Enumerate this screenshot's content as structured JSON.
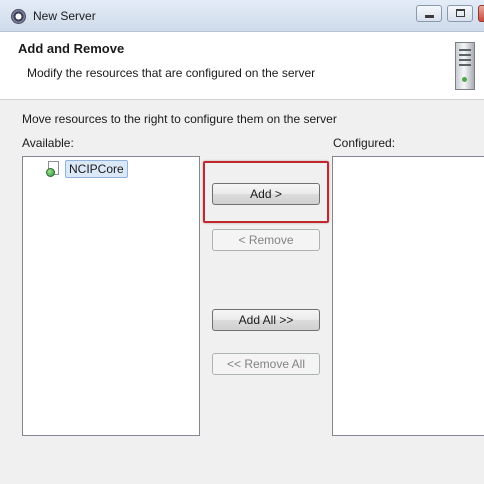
{
  "window": {
    "title": "New Server"
  },
  "header": {
    "title": "Add and Remove",
    "description": "Modify the resources that are configured on the server"
  },
  "main": {
    "instruction": "Move resources to the right to configure them on the server",
    "available_label": "Available:",
    "configured_label": "Configured:",
    "available_items": [
      {
        "label": "NCIPCore",
        "icon": "web-project-icon"
      }
    ],
    "configured_items": []
  },
  "buttons": {
    "add": "Add >",
    "remove": "< Remove",
    "add_all": "Add All >>",
    "remove_all": "<< Remove All"
  },
  "colors": {
    "highlight": "#c0282f",
    "selection": "#dbe8f8"
  }
}
